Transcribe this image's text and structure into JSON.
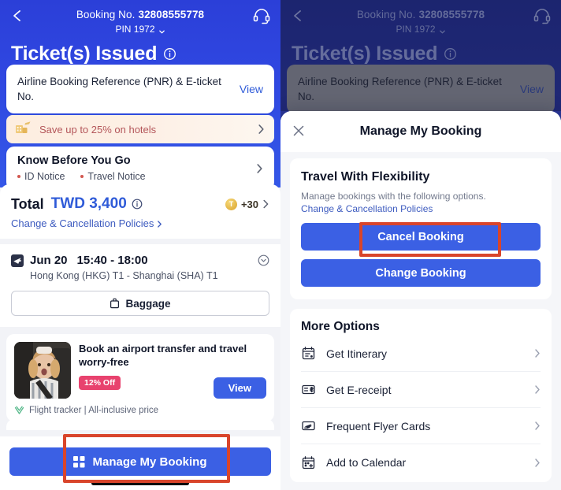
{
  "theme": {
    "hero_blue": "#2f46e0",
    "hero_blue_dimmed": "#2a3596",
    "accent_blue": "#3b60e4",
    "link_blue": "#3d5bbf",
    "highlight_red": "#d9452b",
    "badge_pink": "#e8426e",
    "page_bg": "#f2f3f7"
  },
  "header": {
    "back_icon": "chevron-left-icon",
    "booking_no_label": "Booking No.",
    "booking_no_value": "32808555778",
    "pin_text": "PIN 1972",
    "pin_caret_icon": "chevron-down-icon",
    "support_icon": "headset-icon",
    "title": "Ticket(s) Issued",
    "title_info_icon": "info-circle-icon"
  },
  "pnr_card": {
    "text": "Airline Booking Reference (PNR) & E-ticket No.",
    "action_label": "View"
  },
  "hotel_banner": {
    "icon": "hotel-plane-icon",
    "text": "Save up to 25% on hotels",
    "chevron_icon": "chevron-right-icon"
  },
  "know_before": {
    "title": "Know Before You Go",
    "tags": [
      "ID Notice",
      "Travel Notice"
    ],
    "chevron_icon": "chevron-right-icon"
  },
  "total": {
    "label": "Total",
    "currency_amount": "TWD 3,400",
    "info_icon": "info-circle-icon",
    "coin_glyph": "T",
    "coin_value": "+30",
    "coin_chevron_icon": "chevron-right-icon",
    "policies_link": "Change & Cancellation Policies",
    "policies_chevron_icon": "chevron-right-icon"
  },
  "flight": {
    "plane_icon": "airplane-badge-icon",
    "date": "Jun 20",
    "time_range": "15:40 - 18:00",
    "expand_icon": "chevron-down-circle-icon",
    "route": "Hong Kong (HKG) T1 - Shanghai (SHA) T1",
    "baggage_icon": "baggage-icon",
    "baggage_label": "Baggage"
  },
  "ad_card": {
    "thumb_icon": "child-in-car-seat-photo",
    "title": "Book an airport transfer and travel worry-free",
    "discount_badge": "12% Off",
    "view_label": "View",
    "footer_icon": "shield-heart-icon",
    "footer_text": "Flight tracker | All-inclusive price"
  },
  "bottom": {
    "grid_icon": "grid-four-squares-icon",
    "manage_label": "Manage My Booking"
  },
  "modal": {
    "close_icon": "close-x-icon",
    "title": "Manage My Booking",
    "flexibility": {
      "title": "Travel With Flexibility",
      "subtitle": "Manage bookings with the following options.",
      "policies_link": "Change & Cancellation Policies",
      "cancel_label": "Cancel Booking",
      "change_label": "Change Booking"
    },
    "more_options": {
      "title": "More Options",
      "items": [
        {
          "label": "Get Itinerary",
          "icon": "itinerary-calendar-icon",
          "chevron": "chevron-right-icon"
        },
        {
          "label": "Get E-receipt",
          "icon": "receipt-dollar-icon",
          "chevron": "chevron-right-icon"
        },
        {
          "label": "Frequent Flyer Cards",
          "icon": "flyer-card-icon",
          "chevron": "chevron-right-icon"
        },
        {
          "label": "Add to Calendar",
          "icon": "calendar-plus-icon",
          "chevron": "chevron-right-icon"
        }
      ]
    }
  },
  "highlights": {
    "manage_my_booking": "Manage My Booking",
    "cancel_booking": "Cancel Booking"
  }
}
